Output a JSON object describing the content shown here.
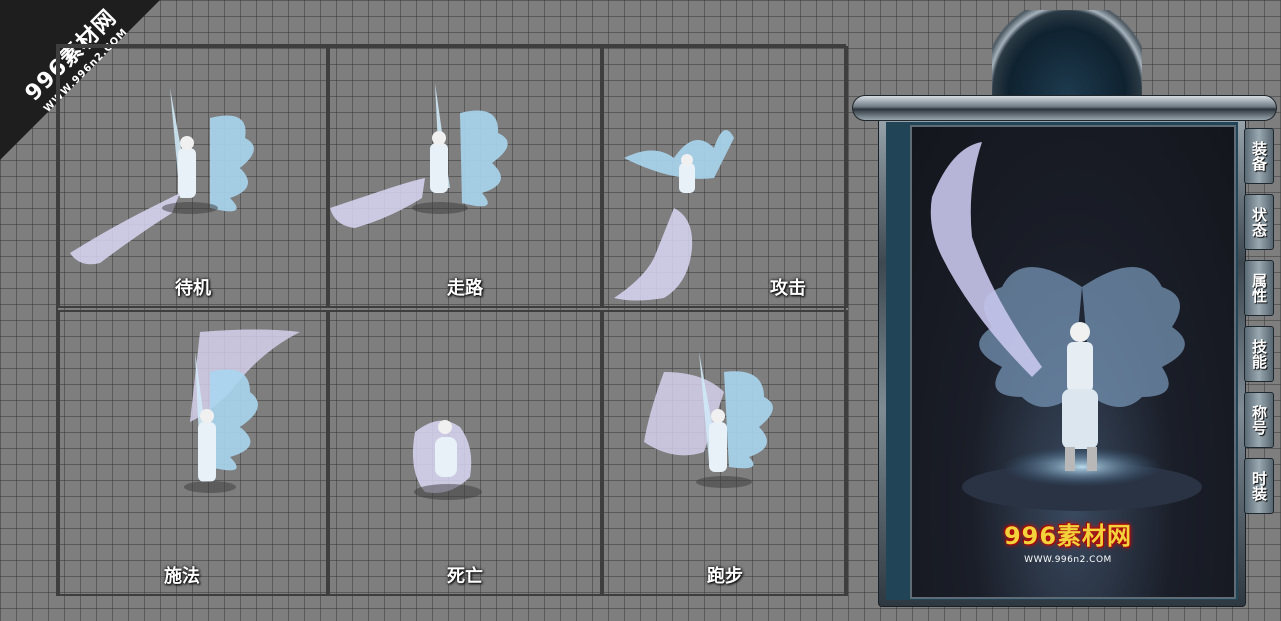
{
  "watermark": {
    "main": "996素材网",
    "sub": "WWW.996n2.COM"
  },
  "animations": [
    {
      "label": "待机"
    },
    {
      "label": "走路"
    },
    {
      "label": "攻击"
    },
    {
      "label": "施法"
    },
    {
      "label": "死亡"
    },
    {
      "label": "跑步"
    }
  ],
  "panel": {
    "tabs": [
      {
        "label": "装备"
      },
      {
        "label": "状态"
      },
      {
        "label": "属性"
      },
      {
        "label": "技能"
      },
      {
        "label": "称号"
      },
      {
        "label": "时装"
      }
    ],
    "logo_main": "996素材网",
    "logo_sub": "WWW.996n2.COM"
  },
  "colors": {
    "background": "#7e7e7e",
    "grid_line": "#3e3e3e",
    "wing": "#bfe4f8",
    "label": "#ffffff",
    "logo": "#f3d23b"
  }
}
